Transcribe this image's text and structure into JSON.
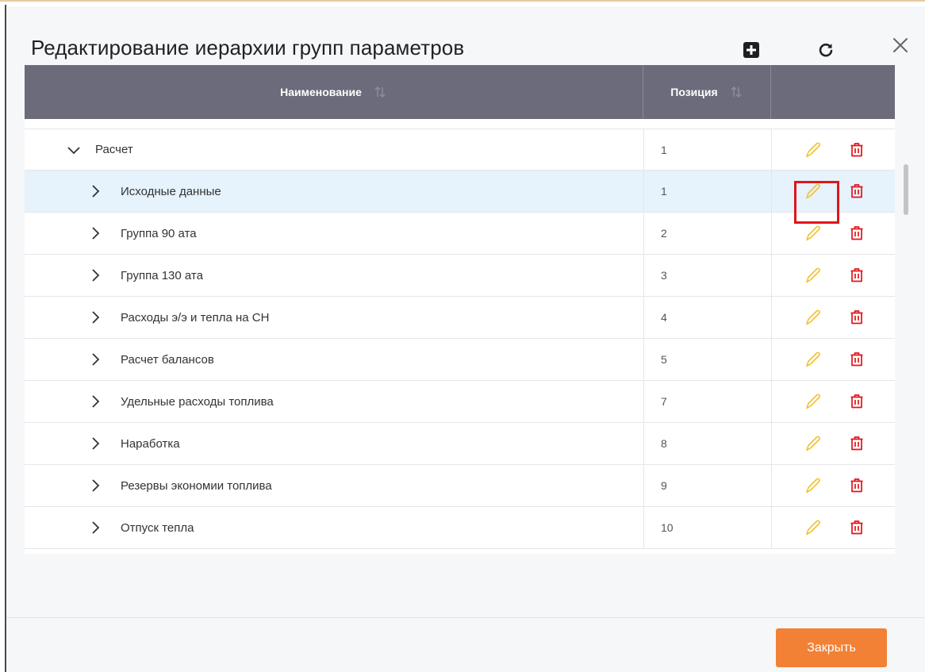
{
  "dialog": {
    "title": "Редактирование иерархии групп параметров",
    "close_button_label": "Закрыть"
  },
  "icons": {
    "add": "plus-square-icon",
    "refresh": "refresh-icon",
    "close": "close-icon",
    "sort": "sort-icon",
    "expand": "chevron-right-icon",
    "collapse": "chevron-down-icon",
    "edit": "pencil-icon",
    "delete": "trash-icon"
  },
  "colors": {
    "header_bg": "#6b6b7b",
    "edit_icon": "#f2c12e",
    "delete_icon": "#e0151b",
    "selected_row": "#e6f2fc",
    "primary_button": "#f28135",
    "highlight_box": "#e0151b"
  },
  "table": {
    "columns": {
      "name": "Наименование",
      "position": "Позиция"
    },
    "rows": [
      {
        "name": "Расчет",
        "position": "1"
      },
      {
        "name": "Исходные данные",
        "position": "1"
      },
      {
        "name": "Группа 90 ата",
        "position": "2"
      },
      {
        "name": "Группа 130 ата",
        "position": "3"
      },
      {
        "name": "Расходы э/э и тепла на СН",
        "position": "4"
      },
      {
        "name": "Расчет балансов",
        "position": "5"
      },
      {
        "name": "Удельные расходы топлива",
        "position": "7"
      },
      {
        "name": "Наработка",
        "position": "8"
      },
      {
        "name": "Резервы экономии топлива",
        "position": "9"
      },
      {
        "name": "Отпуск тепла",
        "position": "10"
      }
    ]
  }
}
